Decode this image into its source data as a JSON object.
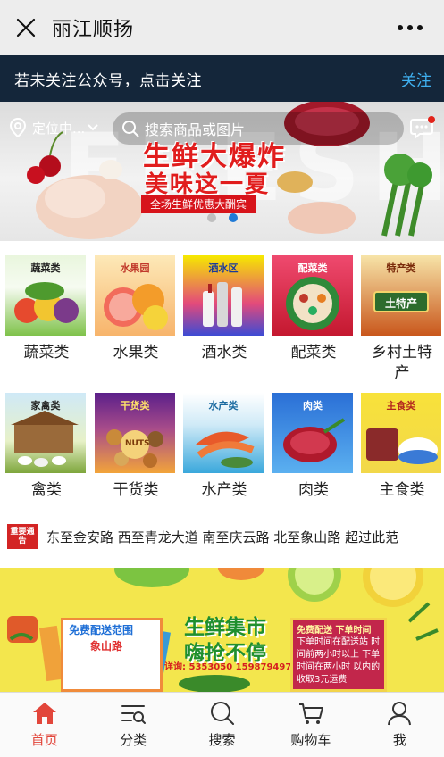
{
  "window": {
    "title": "丽江顺扬"
  },
  "follow_banner": {
    "text": "若未关注公众号，点击关注",
    "button": "关注"
  },
  "hero": {
    "location": "定位中...",
    "search_placeholder": "搜索商品或图片",
    "headline_1": "生鲜大爆炸",
    "headline_2": "美味这一夏",
    "ribbon": "全场生鲜优惠大酬宾",
    "watermark": "FRESH",
    "carousel": {
      "pages": 2,
      "active": 2
    }
  },
  "categories": [
    {
      "label": "蔬菜类",
      "tag": "蔬菜类"
    },
    {
      "label": "水果类",
      "tag": "水果园"
    },
    {
      "label": "酒水类",
      "tag": "酒水区"
    },
    {
      "label": "配菜类",
      "tag": "配菜类"
    },
    {
      "label": "乡村土特产",
      "tag": "特产类",
      "sign": "土特产"
    },
    {
      "label": "禽类",
      "tag": "家禽类"
    },
    {
      "label": "干货类",
      "tag": "干货类",
      "sign": "NUTS"
    },
    {
      "label": "水产类",
      "tag": "水产类"
    },
    {
      "label": "肉类",
      "tag": "肉类"
    },
    {
      "label": "主食类",
      "tag": "主食类"
    }
  ],
  "notice": {
    "badge": "重要通告",
    "text": "东至金安路 西至青龙大道 南至庆云路 北至象山路 超过此范"
  },
  "promo": {
    "line_1": "生鲜集市",
    "line_2": "嗨抢不停",
    "phone": "详询: 5353050 15987949736",
    "card_title": "免费配送范围",
    "card_sub": "象山路",
    "board_title": "免费配送 下单时间",
    "board_body": "下单时间在配送站 时间前两小时以上 下单时间在两小时 以内的收取3元运费"
  },
  "tabs": [
    {
      "label": "首页",
      "icon": "home-icon",
      "active": true
    },
    {
      "label": "分类",
      "icon": "category-icon",
      "active": false
    },
    {
      "label": "搜索",
      "icon": "search-icon",
      "active": false
    },
    {
      "label": "购物车",
      "icon": "cart-icon",
      "active": false
    },
    {
      "label": "我",
      "icon": "user-icon",
      "active": false
    }
  ],
  "colors": {
    "banner_bg": "#14263a",
    "follow_button": "#3fb0f0",
    "active_tab": "#e2463b",
    "headline_red": "#e11d1d"
  }
}
